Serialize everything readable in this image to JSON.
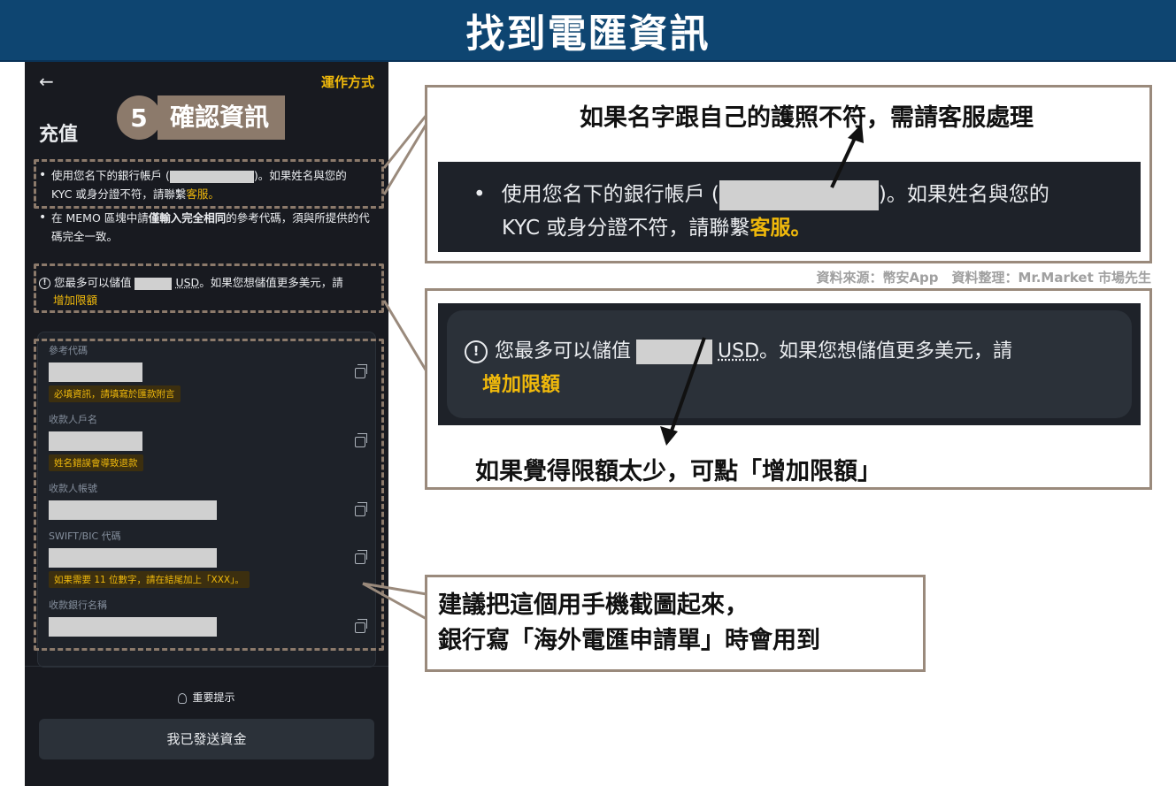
{
  "banner": {
    "title": "找到電匯資訊"
  },
  "phone": {
    "back_glyph": "←",
    "how_it_works": "運作方式",
    "title": "充值",
    "step": {
      "number": "5",
      "label": "確認資訊"
    },
    "bullets": {
      "b1_pre": "使用您名下的銀行帳戶 (",
      "b1_post": ")。如果姓名與您的",
      "b1_line2": "KYC 或身分證不符，請聯繫",
      "b1_link": "客服。",
      "b2_pre": "在 MEMO 區塊中請",
      "b2_bold": "僅輸入完全相同",
      "b2_post": "的參考代碼，須與所提供的代碼完全一致。"
    },
    "limit": {
      "pre": "您最多可以儲值",
      "unit": "USD",
      "post": "。如果您想儲值更多美元，請",
      "link": "增加限額"
    },
    "fields": [
      {
        "label": "參考代碼",
        "tag": "必填資訊，請填寫於匯款附言"
      },
      {
        "label": "收款人戶名",
        "tag": "姓名錯誤會導致退款"
      },
      {
        "label": "收款人帳號",
        "tag": ""
      },
      {
        "label": "SWIFT/BIC 代碼",
        "tag": "如果需要 11 位數字，請在結尾加上「XXX」。"
      },
      {
        "label": "收款銀行名稱",
        "tag": ""
      }
    ],
    "tip": "重要提示",
    "button": "我已發送資金"
  },
  "callout1": {
    "note": "如果名字跟自己的護照不符，需請客服處理",
    "zoom_pre": "使用您名下的銀行帳戶 (",
    "zoom_post": ")。如果姓名與您的",
    "zoom_line2": "KYC 或身分證不符，請聯繫",
    "zoom_link": "客服。"
  },
  "source": "資料來源：幣安App　資料整理：Mr.Market 市場先生",
  "callout2": {
    "zoom_pre": "您最多可以儲值",
    "zoom_unit": "USD",
    "zoom_post": "。如果您想儲值更多美元，請",
    "zoom_link": "增加限額",
    "note": "如果覺得限額太少，可點「增加限額」"
  },
  "callout3": {
    "line1": "建議把這個用手機截圖起來，",
    "line2": "銀行寫「海外電匯申請單」時會用到"
  },
  "colors": {
    "banner": "#0e4571",
    "accent": "#f0b90b",
    "callout_border": "#9a8a7c",
    "app_bg": "#181a20"
  }
}
